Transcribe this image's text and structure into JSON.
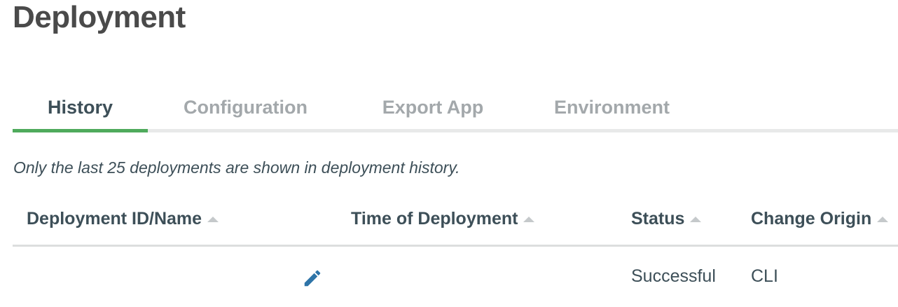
{
  "page": {
    "title": "Deployment"
  },
  "tabs": [
    {
      "label": "History",
      "active": true
    },
    {
      "label": "Configuration",
      "active": false
    },
    {
      "label": "Export App",
      "active": false
    },
    {
      "label": "Environment",
      "active": false
    }
  ],
  "notice": "Only the last 25 deployments are shown in deployment history.",
  "table": {
    "columns": [
      {
        "label": "Deployment ID/Name",
        "sortable": true
      },
      {
        "label": "Time of Deployment",
        "sortable": true
      },
      {
        "label": "Status",
        "sortable": true
      },
      {
        "label": "Change Origin",
        "sortable": true
      }
    ],
    "rows": [
      {
        "deployment_id_name": "",
        "edit_icon": "pencil-icon",
        "time_of_deployment": "",
        "status": "Successful",
        "change_origin": "CLI"
      }
    ]
  },
  "colors": {
    "active_tab_underline": "#4faa5c",
    "edit_icon": "#2e74a8",
    "inactive_tab_text": "#a3a8ab",
    "text": "#3d4f58"
  }
}
